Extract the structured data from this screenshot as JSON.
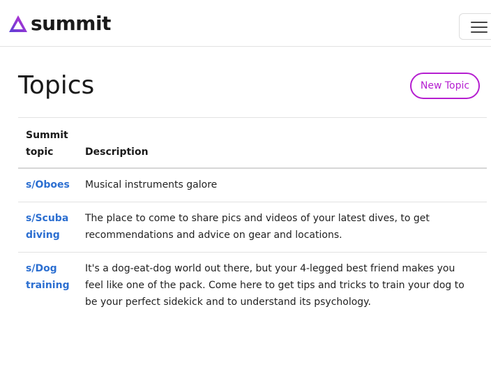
{
  "navbar": {
    "brand_name": "summit",
    "brand_colors": {
      "start": "#5a3fd6",
      "end": "#c52fd1"
    },
    "menu_icon": "hamburger-icon"
  },
  "page": {
    "title": "Topics",
    "new_topic_label": "New Topic",
    "accent_color": "#b51fd0"
  },
  "table": {
    "headers": [
      "Summit topic",
      "Description"
    ],
    "rows": [
      {
        "topic": "s/Oboes",
        "description": "Musical instruments galore"
      },
      {
        "topic": "s/Scuba diving",
        "description": "The place to come to share pics and videos of your latest dives, to get recommendations and advice on gear and locations."
      },
      {
        "topic": "s/Dog training",
        "description": "It's a dog-eat-dog world out there, but your 4-legged best friend makes you feel like one of the pack. Come here to get tips and tricks to train your dog to be your perfect sidekick and to understand its psychology."
      }
    ],
    "link_color": "#2c6fd1"
  }
}
